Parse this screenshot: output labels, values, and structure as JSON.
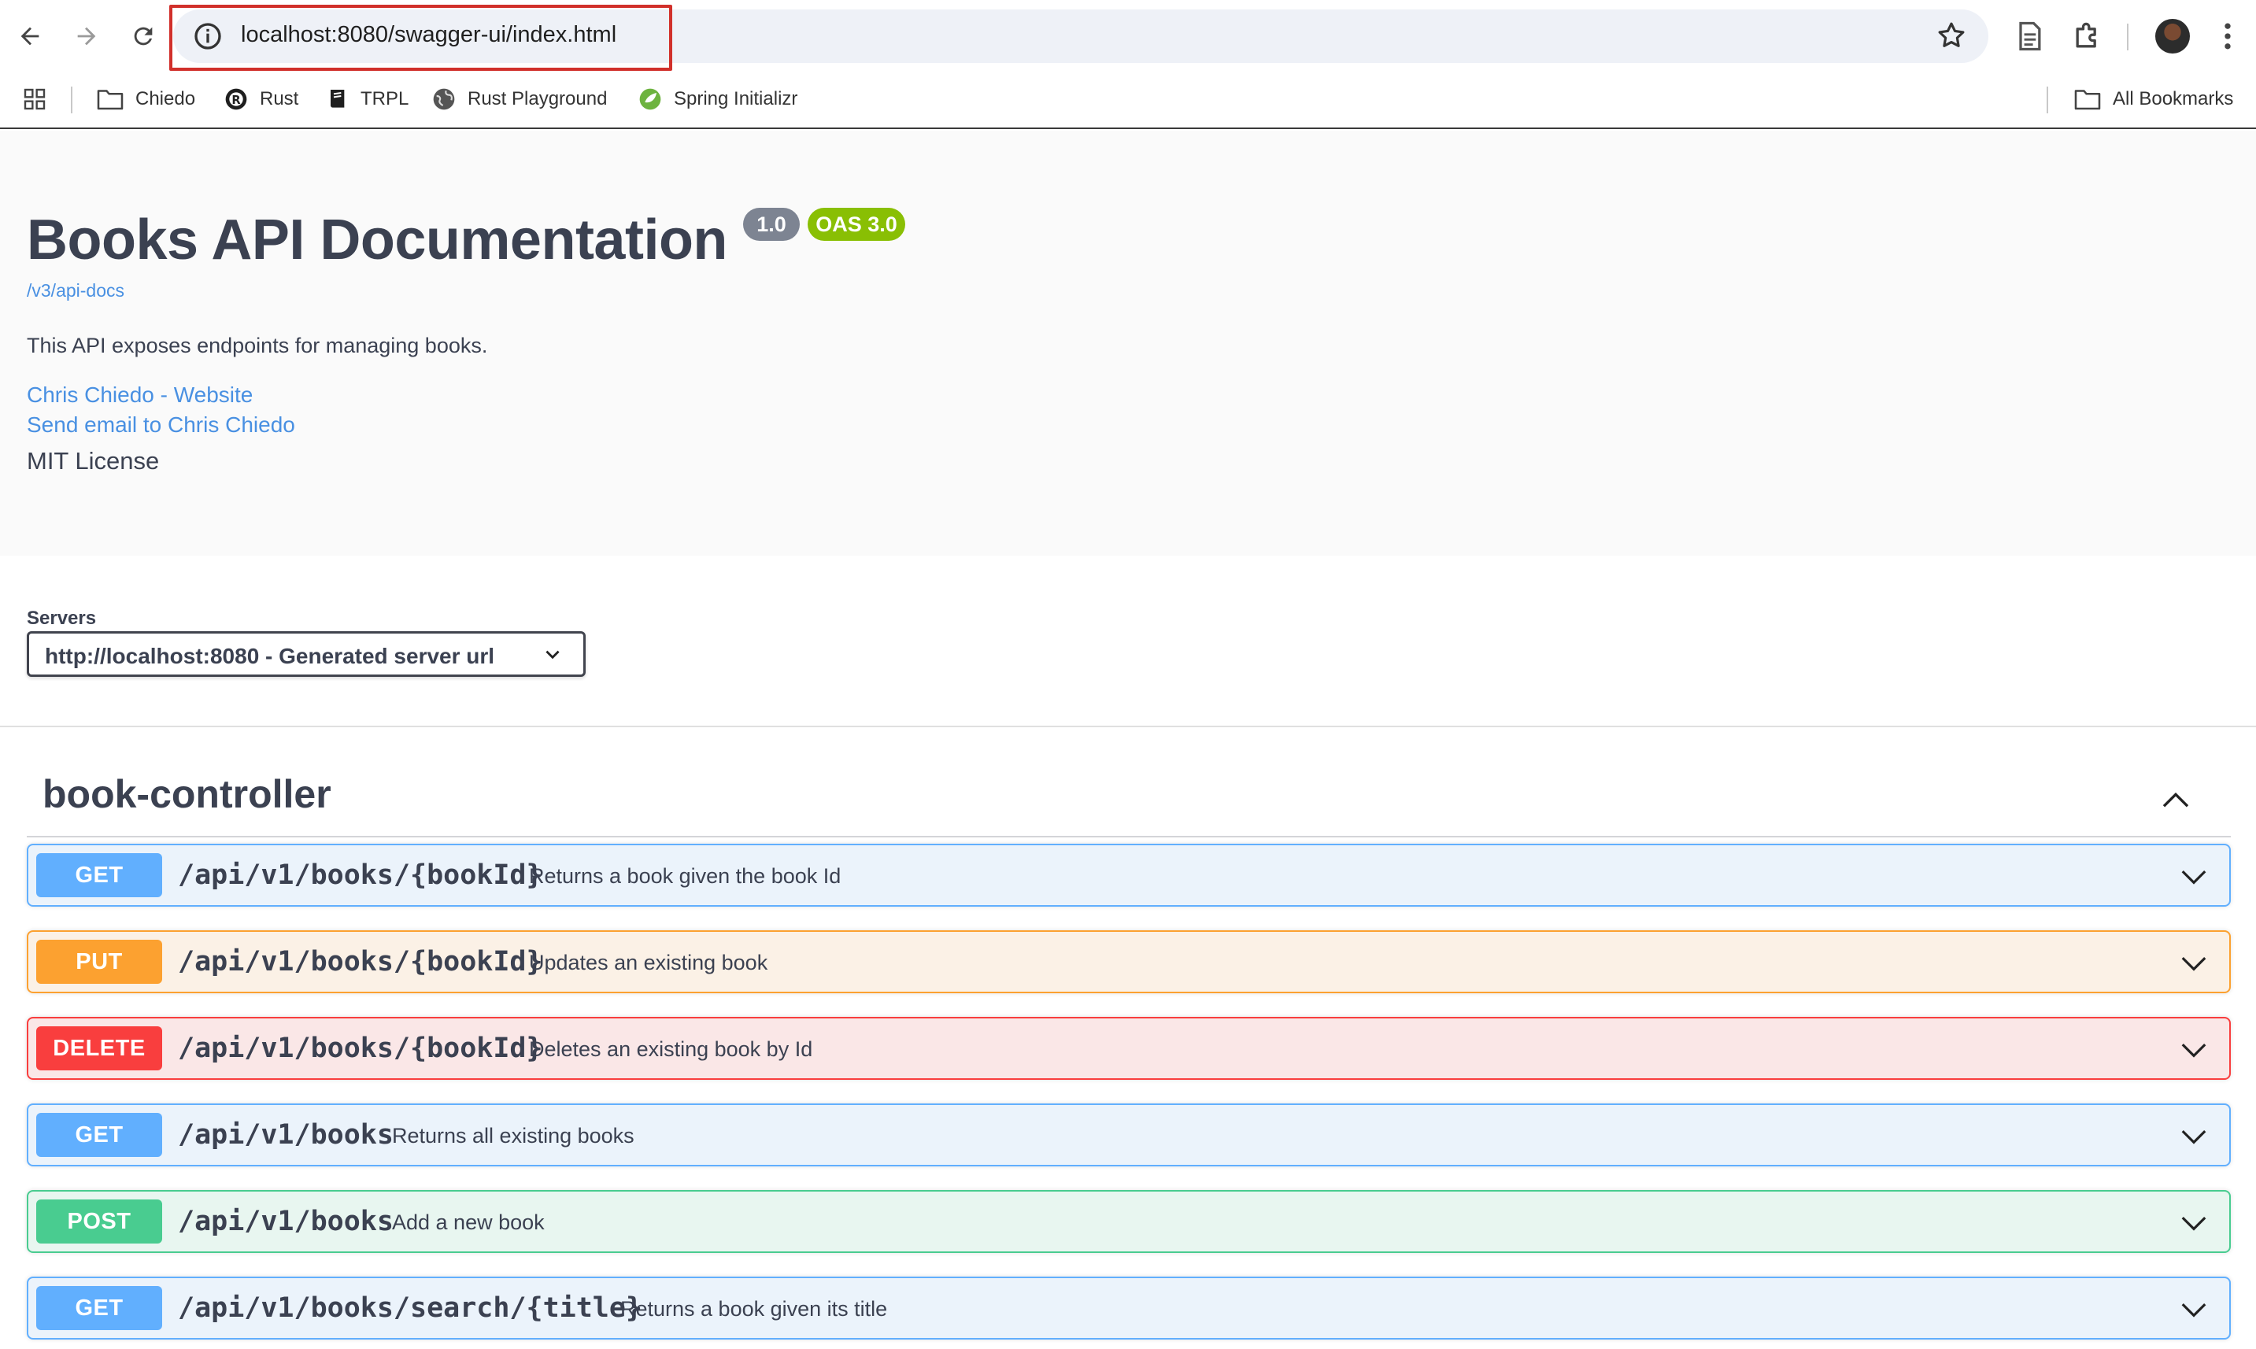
{
  "browser": {
    "url": "localhost:8080/swagger-ui/index.html",
    "bookmarks": [
      {
        "label": "Chiedo",
        "icon": "folder-icon"
      },
      {
        "label": "Rust",
        "icon": "rust-logo-icon"
      },
      {
        "label": "TRPL",
        "icon": "book-icon"
      },
      {
        "label": "Rust Playground",
        "icon": "globe-icon"
      },
      {
        "label": "Spring Initializr",
        "icon": "spring-logo-icon"
      }
    ],
    "all_bookmarks_label": "All Bookmarks",
    "highlight_color": "#d1302b"
  },
  "info": {
    "title": "Books API Documentation",
    "version": "1.0",
    "oas": "OAS 3.0",
    "api_docs_link": "/v3/api-docs",
    "description": "This API exposes endpoints for managing books.",
    "contact_website": "Chris Chiedo - Website",
    "contact_email": "Send email to Chris Chiedo",
    "license": "MIT License"
  },
  "servers": {
    "label": "Servers",
    "selected": "http://localhost:8080 - Generated server url"
  },
  "tag": {
    "name": "book-controller",
    "operations": [
      {
        "method": "GET",
        "path": "/api/v1/books/{bookId}",
        "summary": "Returns a book given the book Id"
      },
      {
        "method": "PUT",
        "path": "/api/v1/books/{bookId}",
        "summary": "Updates an existing book"
      },
      {
        "method": "DELETE",
        "path": "/api/v1/books/{bookId}",
        "summary": "Deletes an existing book by Id"
      },
      {
        "method": "GET",
        "path": "/api/v1/books",
        "summary": "Returns all existing books"
      },
      {
        "method": "POST",
        "path": "/api/v1/books",
        "summary": "Add a new book"
      },
      {
        "method": "GET",
        "path": "/api/v1/books/search/{title}",
        "summary": "Returns a book given its title"
      }
    ]
  },
  "colors": {
    "get": "#61affe",
    "put": "#fca130",
    "delete": "#f93e3e",
    "post": "#49cc90",
    "link": "#4990e2",
    "version_badge": "#7d8492",
    "oas_badge": "#89bf04"
  }
}
